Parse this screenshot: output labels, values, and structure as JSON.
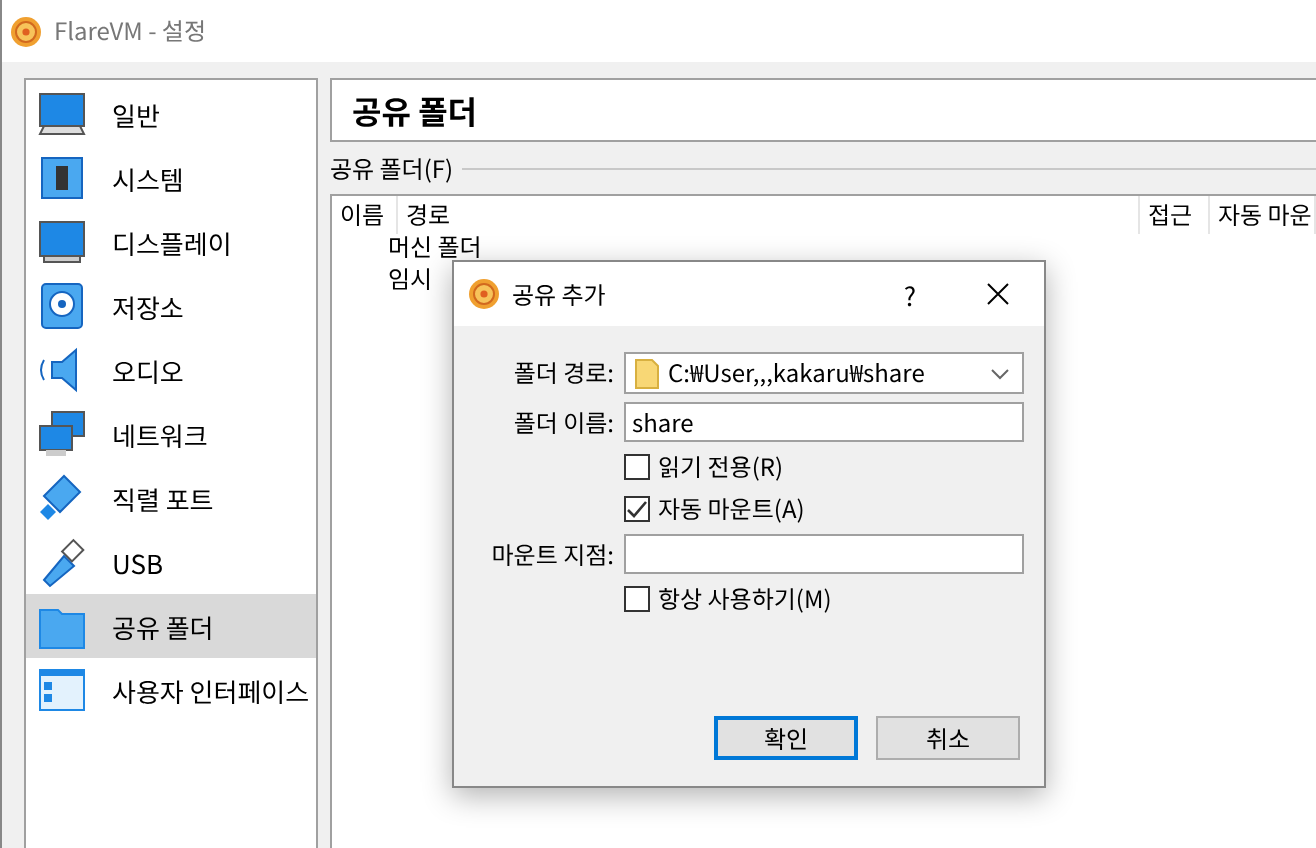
{
  "window": {
    "title": "FlareVM - 설정"
  },
  "sidebar": {
    "items": [
      {
        "label": "일반",
        "kind": "general",
        "selected": false
      },
      {
        "label": "시스템",
        "kind": "system",
        "selected": false
      },
      {
        "label": "디스플레이",
        "kind": "display",
        "selected": false
      },
      {
        "label": "저장소",
        "kind": "storage",
        "selected": false
      },
      {
        "label": "오디오",
        "kind": "audio",
        "selected": false
      },
      {
        "label": "네트워크",
        "kind": "network",
        "selected": false
      },
      {
        "label": "직렬 포트",
        "kind": "serial",
        "selected": false
      },
      {
        "label": "USB",
        "kind": "usb",
        "selected": false
      },
      {
        "label": "공유 폴더",
        "kind": "folder",
        "selected": true
      },
      {
        "label": "사용자 인터페이스",
        "kind": "ui",
        "selected": false
      }
    ]
  },
  "page_title": "공유 폴더",
  "group_label": "공유 폴더(F)",
  "table": {
    "columns": [
      "이름",
      "경로",
      "접근",
      "자동 마운"
    ],
    "rows": [
      "머신 폴더",
      "임시"
    ]
  },
  "dialog": {
    "title": "공유 추가",
    "help": "?",
    "fields": [
      {
        "kind": "combo",
        "label": "폴더 경로:",
        "value": "C:₩User,,,kakaru₩share"
      },
      {
        "kind": "text",
        "label": "폴더 이름:",
        "value": "share"
      },
      {
        "kind": "check",
        "label": "읽기 전용(R)",
        "checked": false
      },
      {
        "kind": "check",
        "label": "자동 마운트(A)",
        "checked": true
      },
      {
        "kind": "text",
        "label": "마운트 지점:"
      },
      {
        "kind": "check",
        "label": "항상 사용하기(M)",
        "checked": false
      }
    ],
    "buttons": [
      {
        "label": "확인",
        "default": true
      },
      {
        "label": "취소",
        "default": false
      }
    ]
  }
}
